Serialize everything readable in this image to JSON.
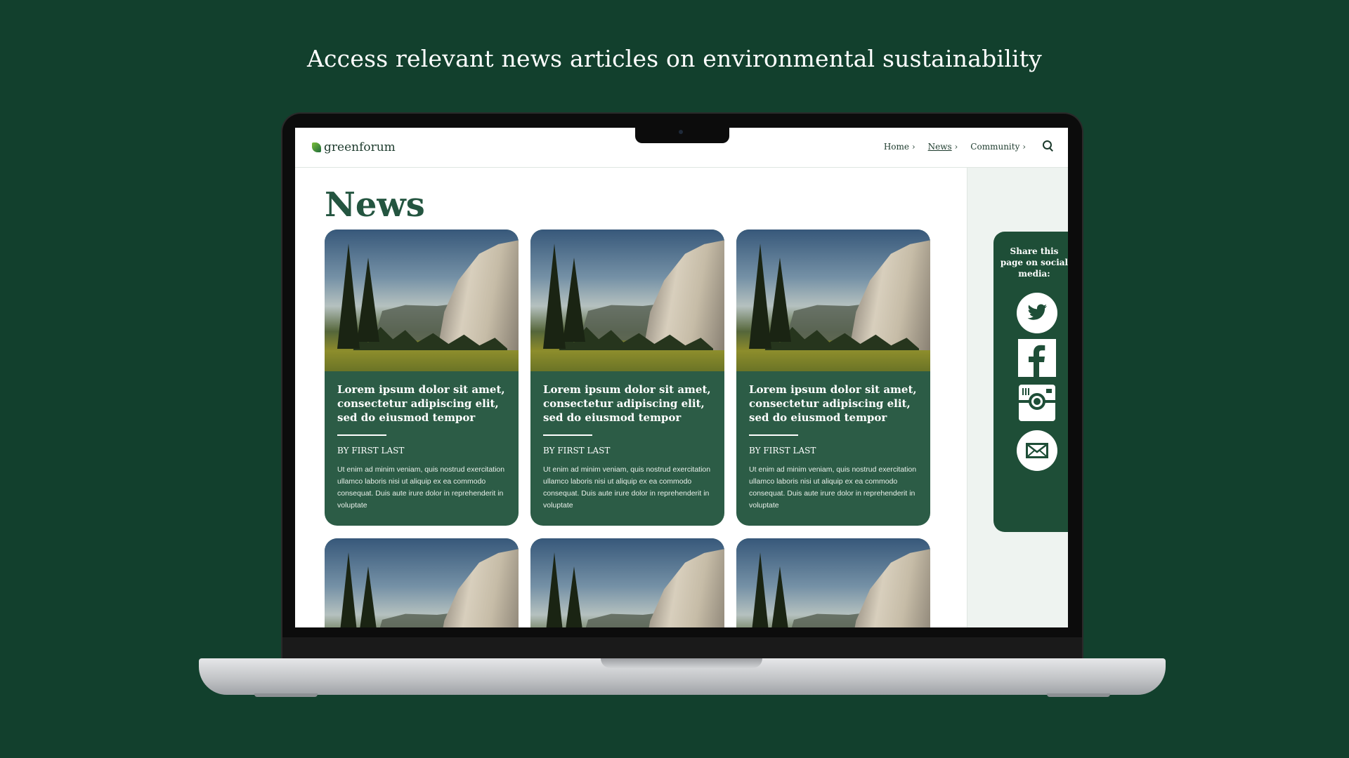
{
  "headline": "Access relevant news articles on environmental sustainability",
  "site": {
    "logo_text": "greenforum",
    "nav": [
      {
        "label": "Home",
        "chevron": "›"
      },
      {
        "label": "News",
        "chevron": "›"
      },
      {
        "label": "Community",
        "chevron": "›"
      }
    ],
    "search_icon": "search-icon",
    "page_title": "News"
  },
  "articles": [
    {
      "title": "Lorem ipsum dolor sit amet, consectetur adipiscing elit, sed do eiusmod tempor",
      "author": "BY FIRST LAST",
      "excerpt": "Ut enim ad minim veniam, quis nostrud exercitation ullamco laboris nisi ut aliquip ex ea commodo consequat. Duis aute irure dolor in reprehenderit in voluptate"
    },
    {
      "title": "Lorem ipsum dolor sit amet, consectetur adipiscing elit, sed do eiusmod tempor",
      "author": "BY FIRST LAST",
      "excerpt": "Ut enim ad minim veniam, quis nostrud exercitation ullamco laboris nisi ut aliquip ex ea commodo consequat. Duis aute irure dolor in reprehenderit in voluptate"
    },
    {
      "title": "Lorem ipsum dolor sit amet, consectetur adipiscing elit, sed do eiusmod tempor",
      "author": "BY FIRST LAST",
      "excerpt": "Ut enim ad minim veniam, quis nostrud exercitation ullamco laboris nisi ut aliquip ex ea commodo consequat. Duis aute irure dolor in reprehenderit in voluptate"
    }
  ],
  "share": {
    "label": "Share this page on social media:",
    "icons": [
      "twitter-icon",
      "facebook-icon",
      "instagram-icon",
      "email-icon"
    ]
  },
  "colors": {
    "background": "#12402d",
    "card": "#2c5c46",
    "share_panel": "#1e4e37",
    "title": "#245540"
  }
}
